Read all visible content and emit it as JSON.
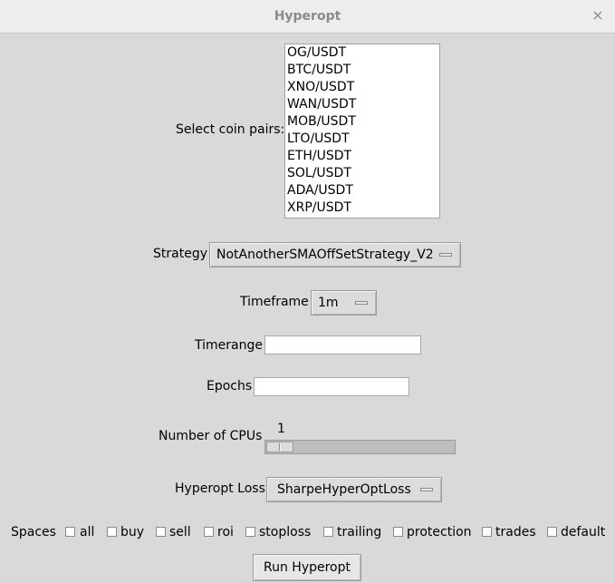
{
  "window": {
    "title": "Hyperopt",
    "close_glyph": "×"
  },
  "coin_pairs": {
    "label": "Select coin pairs:",
    "items": [
      "OG/USDT",
      "BTC/USDT",
      "XNO/USDT",
      "WAN/USDT",
      "MOB/USDT",
      "LTO/USDT",
      "ETH/USDT",
      "SOL/USDT",
      "ADA/USDT",
      "XRP/USDT"
    ]
  },
  "strategy": {
    "label": "Strategy",
    "value": "NotAnotherSMAOffSetStrategy_V2"
  },
  "timeframe": {
    "label": "Timeframe",
    "value": "1m"
  },
  "timerange": {
    "label": "Timerange",
    "value": ""
  },
  "epochs": {
    "label": "Epochs",
    "value": ""
  },
  "cpus": {
    "label": "Number of CPUs",
    "value": "1"
  },
  "hyperopt_loss": {
    "label": "Hyperopt Loss",
    "value": "SharpeHyperOptLoss"
  },
  "spaces": {
    "label": "Spaces",
    "options": [
      {
        "label": "all",
        "checked": false
      },
      {
        "label": "buy",
        "checked": false
      },
      {
        "label": "sell",
        "checked": false
      },
      {
        "label": "roi",
        "checked": false
      },
      {
        "label": "stoploss",
        "checked": false
      },
      {
        "label": "trailing",
        "checked": false
      },
      {
        "label": "protection",
        "checked": false
      },
      {
        "label": "trades",
        "checked": false
      },
      {
        "label": "default",
        "checked": false
      }
    ]
  },
  "run_button": {
    "label": "Run Hyperopt"
  },
  "colors": {
    "background": "#d9d9d9",
    "titlebar": "#ededed",
    "field": "#ffffff"
  },
  "icons": {
    "close": "close-icon",
    "menu_indicator": "menu-indicator-icon"
  }
}
